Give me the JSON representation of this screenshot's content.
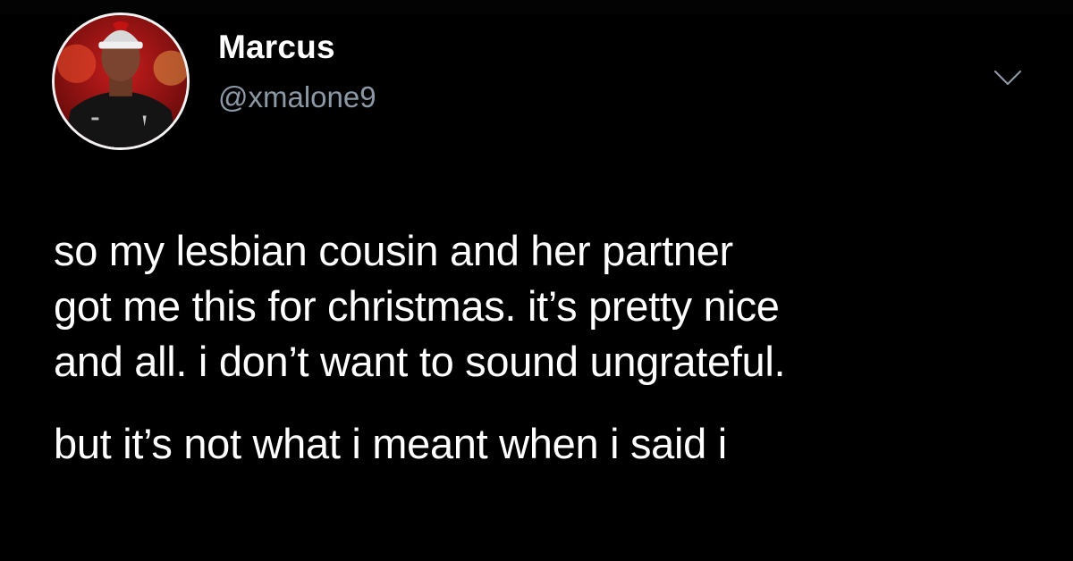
{
  "author": {
    "display_name": "Marcus",
    "handle": "@xmalone9",
    "avatar_icon": "profile-photo"
  },
  "menu": {
    "icon": "chevron-down-icon"
  },
  "tweet": {
    "lines": [
      "so my lesbian cousin and her partner",
      "got me this for christmas. it’s pretty nice",
      "and all. i don’t want to sound ungrateful.",
      "but it’s not what i meant when i said i"
    ]
  },
  "colors": {
    "background": "#000000",
    "text_primary": "#ffffff",
    "text_secondary": "#8b98a5"
  }
}
